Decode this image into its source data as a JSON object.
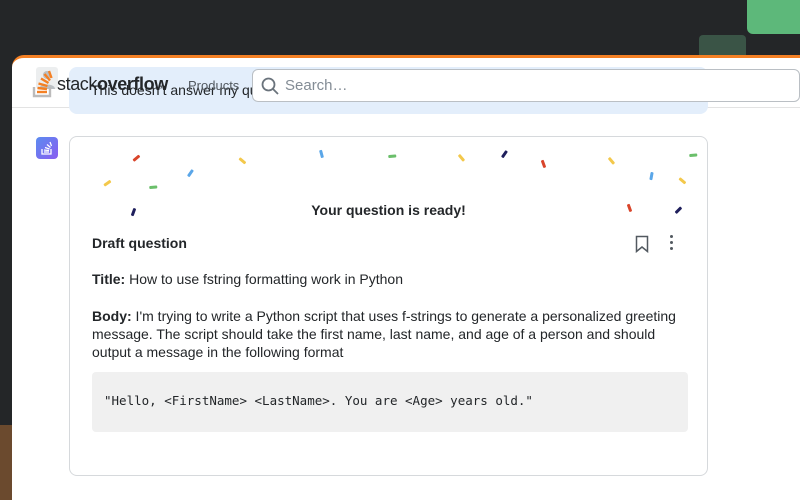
{
  "header": {
    "logo_light": "stack",
    "logo_bold": "overflow",
    "products": "Products",
    "search_placeholder": "Search…"
  },
  "user_message": "This doesn’t answer my question, help me draft a question to post on Stack Overflow.",
  "response": {
    "ready": "Your question is ready!",
    "draft_heading": "Draft question",
    "title_label": "Title:",
    "title": " How to use fstring formatting work in Python",
    "body_label": "Body:",
    "body": " I'm trying to write a Python script that uses f-strings to generate a personalized greeting message. The script should take the first name, last name, and age of a person and should output a message in the following format",
    "code": "\"Hello, <FirstName> <LastName>. You are <Age> years old.\""
  }
}
